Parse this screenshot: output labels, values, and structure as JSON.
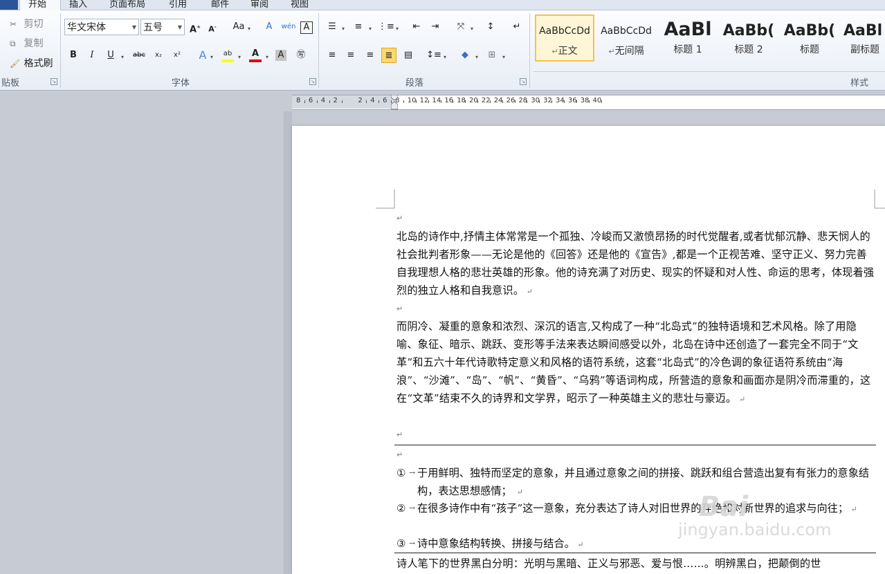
{
  "tabs": [
    "开始",
    "插入",
    "页面布局",
    "引用",
    "邮件",
    "审阅",
    "视图"
  ],
  "clipboard": {
    "cut": "剪切",
    "copy": "复制",
    "format_painter": "格式刷",
    "label": "贴板"
  },
  "font": {
    "name": "华文宋体",
    "size": "五号",
    "label": "字体"
  },
  "paragraph": {
    "label": "段落"
  },
  "styles": {
    "label": "样式",
    "items": [
      {
        "sample": "AaBbCcDd",
        "name": "正文",
        "mark": "↵"
      },
      {
        "sample": "AaBbCcDd",
        "name": "无间隔",
        "mark": "↵"
      },
      {
        "sample": "AaBl",
        "name": "标题 1"
      },
      {
        "sample": "AaBb(",
        "name": "标题 2"
      },
      {
        "sample": "AaBb(",
        "name": "标题"
      },
      {
        "sample": "AaBl",
        "name": "副标题"
      }
    ]
  },
  "ruler": {
    "numbers": [
      "8",
      "6",
      "4",
      "2",
      "2",
      "4",
      "6",
      "8",
      "10",
      "12",
      "14",
      "16",
      "18",
      "20",
      "22",
      "24",
      "26",
      "28",
      "30",
      "32",
      "34",
      "36",
      "38",
      "40"
    ]
  },
  "document": {
    "para1": "北岛的诗作中,抒情主体常常是一个孤独、冷峻而又激愤昂扬的时代觉醒者,或者忧郁沉静、悲天悯人的社会批判者形象——无论是他的《回答》还是他的《宣告》,都是一个正视苦难、坚守正义、努力完善自我理想人格的悲壮英雄的形象。他的诗充满了对历史、现实的怀疑和对人性、命运的思考，体现着强烈的独立人格和自我意识。",
    "para2": "而阴冷、凝重的意象和浓烈、深沉的语言,又构成了一种“北岛式”的独特语境和艺术风格。除了用隐喻、象征、暗示、跳跃、变形等手法来表达瞬间感受以外，北岛在诗中还创造了一套完全不同于“文革”和五六十年代诗歌特定意义和风格的语符系统，这套“北岛式”的冷色调的象征语符系统由“海浪”、“沙滩”、“岛”、“帆”、“黄昏”、“乌鸦”等语词构成，所营造的意象和画面亦是阴冷而滞重的，这在“文革”结束不久的诗界和文学界，昭示了一种英雄主义的悲壮与豪迈。",
    "list": [
      {
        "num": "①",
        "text": "于用鲜明、独特而坚定的意象，并且通过意象之间的拼接、跳跃和组合营造出复有有张力的意象结构，表达思想感情；"
      },
      {
        "num": "②",
        "text": "在很多诗作中有“孩子”这一意象，充分表达了诗人对旧世界的弃绝和对新世界的追求与向往；"
      },
      {
        "num": "③",
        "text": "诗中意象结构转换、拼接与结合。"
      }
    ],
    "para3": "诗人笔下的世界黑白分明：光明与黑暗、正义与邪恶、爱与恨……。明辨黑白，把颠倒的世"
  },
  "watermark": {
    "line1": "Bai",
    "line2": "jingyan.baidu.com"
  },
  "colors": {
    "highlight": "#ffff00",
    "font_color": "#e00000",
    "accent": "#2a5699"
  }
}
